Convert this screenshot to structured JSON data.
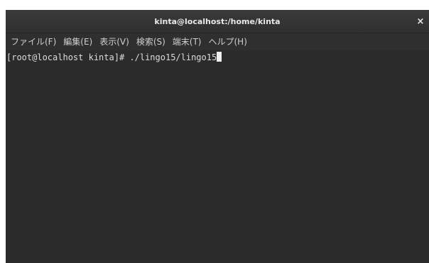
{
  "window": {
    "title": "kinta@localhost:/home/kinta",
    "close_glyph": "×"
  },
  "menu": {
    "items": [
      {
        "label": "ファイル(F)"
      },
      {
        "label": "編集(E)"
      },
      {
        "label": "表示(V)"
      },
      {
        "label": "検索(S)"
      },
      {
        "label": "端末(T)"
      },
      {
        "label": "ヘルプ(H)"
      }
    ]
  },
  "terminal": {
    "prompt": "[root@localhost kinta]# ",
    "command": "./lingo15/lingo15",
    "cursor": "cursor-block"
  }
}
